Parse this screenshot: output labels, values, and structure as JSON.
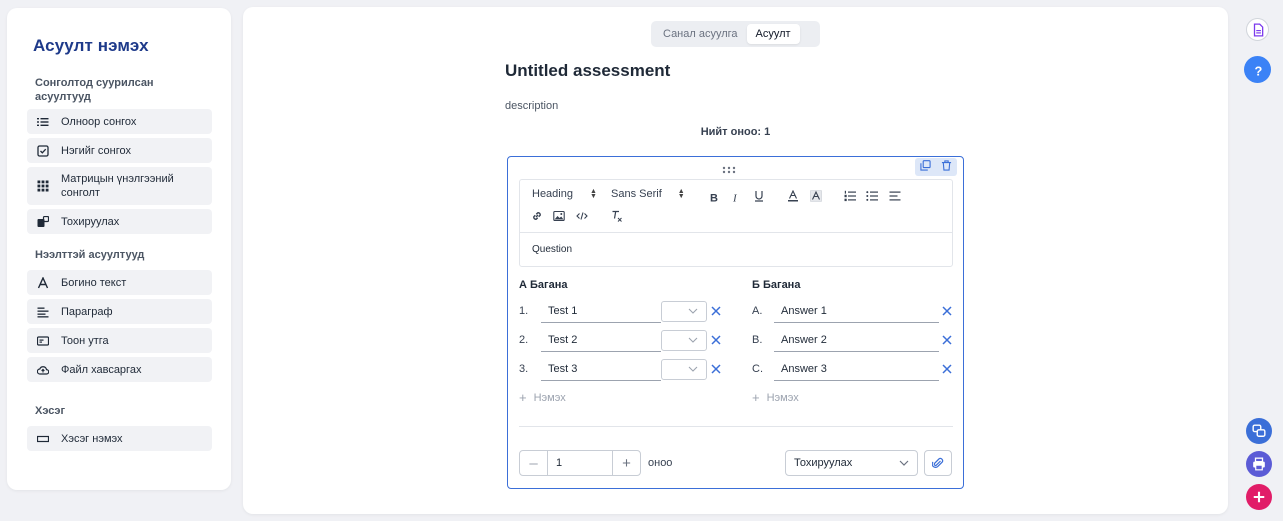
{
  "sidebar": {
    "title": "Асуулт нэмэх",
    "sections": [
      {
        "title": "Сонголтод суурилсан асуултууд",
        "items": [
          {
            "label": "Олноор сонгох",
            "icon": "list-icon"
          },
          {
            "label": "Нэгийг сонгох",
            "icon": "checkbox-icon"
          },
          {
            "label": "Матрицын үнэлгээний сонголт",
            "icon": "grid-icon"
          },
          {
            "label": "Тохируулах",
            "icon": "match-icon"
          }
        ]
      },
      {
        "title": "Нээлттэй асуултууд",
        "items": [
          {
            "label": "Богино текст",
            "icon": "text-a-icon"
          },
          {
            "label": "Параграф",
            "icon": "paragraph-icon"
          },
          {
            "label": "Тоон утга",
            "icon": "number-icon"
          },
          {
            "label": "Файл хавсаргах",
            "icon": "cloud-upload-icon"
          }
        ]
      },
      {
        "title": "Хэсэг",
        "items": [
          {
            "label": "Хэсэг нэмэх",
            "icon": "section-icon"
          }
        ]
      }
    ]
  },
  "mode_toggle": {
    "options": [
      "Санал асуулга",
      "Асуулт"
    ],
    "active": "Асуулт"
  },
  "assessment": {
    "title": "Untitled assessment",
    "description": "description",
    "total_points": "Нийт оноо: 1"
  },
  "question": {
    "toolbar": {
      "heading": "Heading",
      "font": "Sans Serif"
    },
    "content": "Question",
    "column_a": {
      "title": "А Багана",
      "rows": [
        {
          "marker": "1.",
          "text": "Test 1"
        },
        {
          "marker": "2.",
          "text": "Test 2"
        },
        {
          "marker": "3.",
          "text": "Test 3"
        }
      ]
    },
    "column_b": {
      "title": "Б Багана",
      "rows": [
        {
          "marker": "A.",
          "text": "Answer 1"
        },
        {
          "marker": "B.",
          "text": "Answer 2"
        },
        {
          "marker": "C.",
          "text": "Answer 3"
        }
      ]
    },
    "add_label": "Нэмэх",
    "points_value": "1",
    "points_label": "оноо",
    "type_select": "Тохируулах"
  },
  "colors": {
    "accent": "#3b6fd8",
    "title": "#1e3a8a",
    "help": "#3b82f6",
    "add": "#e11d68",
    "print": "#5b5bd6"
  }
}
